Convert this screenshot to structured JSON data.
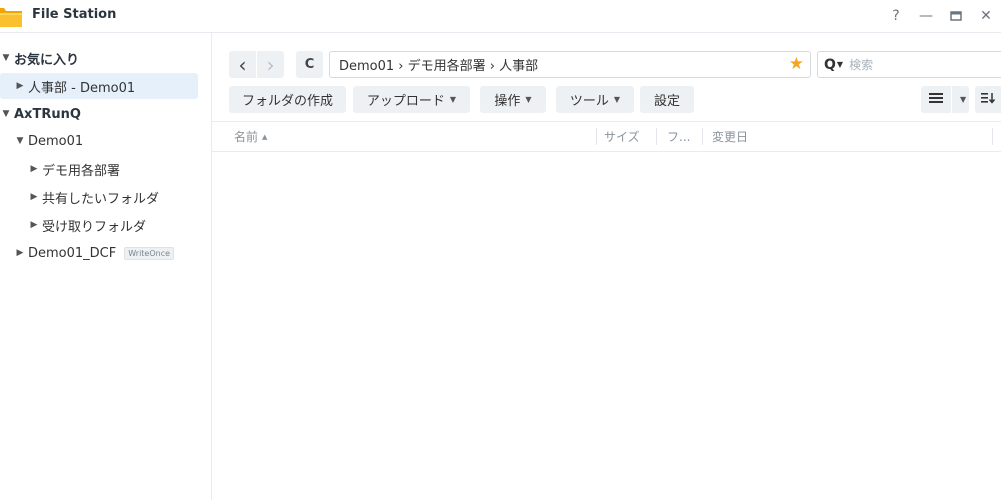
{
  "window": {
    "title": "File Station",
    "controls": {
      "help": "?",
      "minimize": "—",
      "maximize": "▭",
      "close": "✕"
    }
  },
  "sidebar": {
    "items": [
      {
        "label": "お気に入り",
        "level": 0,
        "expanded": true,
        "bold": true
      },
      {
        "label": "人事部 - Demo01",
        "level": 1,
        "expanded": false,
        "selected": true
      },
      {
        "label": "AxTRunQ",
        "level": 0,
        "expanded": true,
        "bold": true
      },
      {
        "label": "Demo01",
        "level": 1,
        "expanded": true
      },
      {
        "label": "デモ用各部署",
        "level": 2,
        "expanded": false
      },
      {
        "label": "共有したいフォルダ",
        "level": 2,
        "expanded": false
      },
      {
        "label": "受け取りフォルダ",
        "level": 2,
        "expanded": false
      },
      {
        "label": "Demo01_DCF",
        "level": 1,
        "expanded": false,
        "badge": "WriteOnce"
      }
    ]
  },
  "toolbar": {
    "back": "‹",
    "forward": "›",
    "refresh": "C",
    "path": "Demo01 › デモ用各部署 › 人事部",
    "search_placeholder": "検索",
    "buttons": {
      "create_folder": "フォルダの作成",
      "upload": "アップロード",
      "action": "操作",
      "tools": "ツール",
      "settings": "設定"
    }
  },
  "table": {
    "columns": {
      "name": "名前",
      "size": "サイズ",
      "type": "フ...",
      "modified": "変更日"
    },
    "rows": []
  },
  "colors": {
    "accent_star": "#f5a623",
    "selected_bg": "#e5f0fb",
    "button_bg": "#eef1f4"
  }
}
